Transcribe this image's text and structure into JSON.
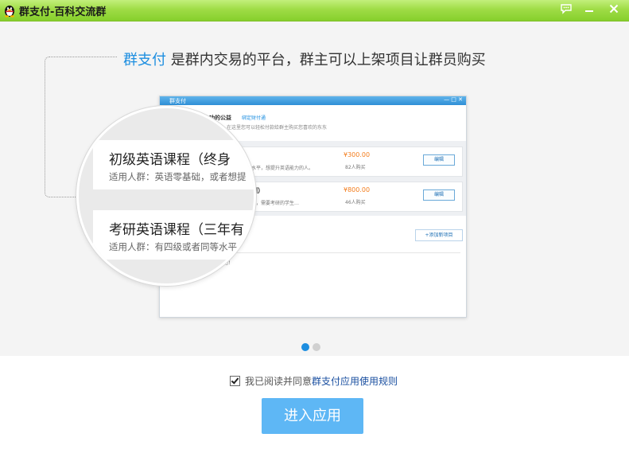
{
  "window": {
    "title": "群支付-百科交流群"
  },
  "titlebar_icons": [
    "chat-bubble-icon",
    "minimize-icon",
    "close-icon"
  ],
  "intro": {
    "brand": "群支付",
    "text": " 是群内交易的平台，群主可以上架项目让群员购买"
  },
  "mini_window": {
    "title": "群支付",
    "controls": "— □ ✕",
    "head_title": "功的公益",
    "head_link": "绑定财付通",
    "head_desc": "在这里您可以轻松付款给群主购买您喜欢的东东",
    "items": [
      {
        "title": "",
        "desc": "水平，想提升英语能力的人。",
        "price": "¥300.00",
        "buyers": "82人购买",
        "edit": "编辑"
      },
      {
        "title": "期）",
        "desc": "力，需要考研的学生…",
        "price": "¥800.00",
        "buyers": "46人购买",
        "edit": "编辑"
      }
    ],
    "add_button": "+添加新项目",
    "footer": "来支付吧！"
  },
  "magnifier": {
    "items": [
      {
        "title": "初级英语课程（终身",
        "desc": "适用人群：英语零基础，或者想提"
      },
      {
        "title": "考研英语课程（三年有",
        "desc": "适用人群：有四级或者同等水平"
      }
    ]
  },
  "pager": {
    "active_index": 0,
    "count": 2,
    "active_color": "#1d8ee0",
    "inactive_color": "#d0d0d0"
  },
  "agreement": {
    "checked": true,
    "text": "我已阅读并同意",
    "link": "群支付应用使用规则"
  },
  "enter_button": {
    "label": "进入应用",
    "color": "#5eb7f5"
  }
}
